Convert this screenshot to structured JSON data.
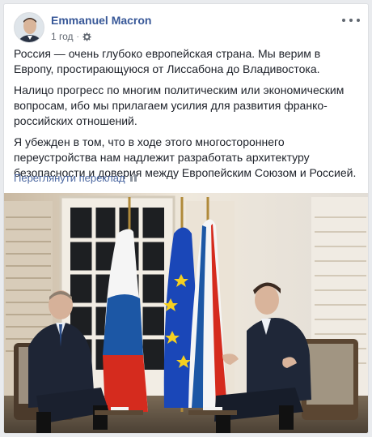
{
  "post": {
    "author": "Emmanuel Macron",
    "time": "1 год",
    "privacy_icon": "gear-icon",
    "paragraphs": [
      "Россия — очень глубоко европейская страна. Мы верим в Европу, простирающуюся от Лиссабона до Владивостока.",
      "Налицо прогресс по многим политическим или экономическим вопросам, ибо мы прилагаем усилия для развития франко-российских отношений.",
      "Я убежден в том, что в ходе этого многостороннего переустройства нам надлежит разработать архитектуру безопасности и доверия между Европейским Союзом и Россией."
    ],
    "translate_label": "Переглянути переклад"
  },
  "colors": {
    "link": "#385898",
    "meta": "#606770",
    "flag_red": "#d52b1e",
    "flag_blue": "#1c57a5",
    "eu_blue": "#1a47b8",
    "eu_star": "#f5d020"
  }
}
